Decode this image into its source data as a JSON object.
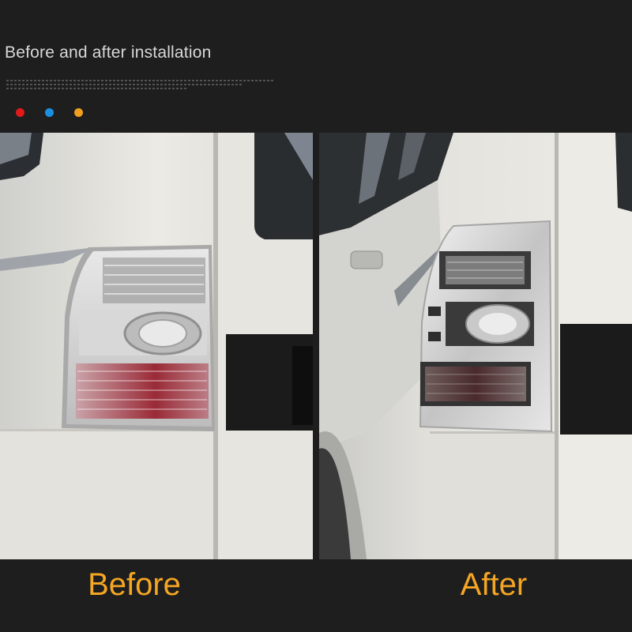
{
  "header": {
    "title": "Before and after installation"
  },
  "swatches": [
    {
      "name": "red",
      "color": "#e11a1a"
    },
    {
      "name": "blue",
      "color": "#1a8fe0"
    },
    {
      "name": "orange",
      "color": "#f0a01e"
    }
  ],
  "panels": {
    "before": {
      "label": "Before"
    },
    "after": {
      "label": "After"
    }
  },
  "colors": {
    "caption": "#f5a623",
    "background": "#1e1e1e"
  }
}
